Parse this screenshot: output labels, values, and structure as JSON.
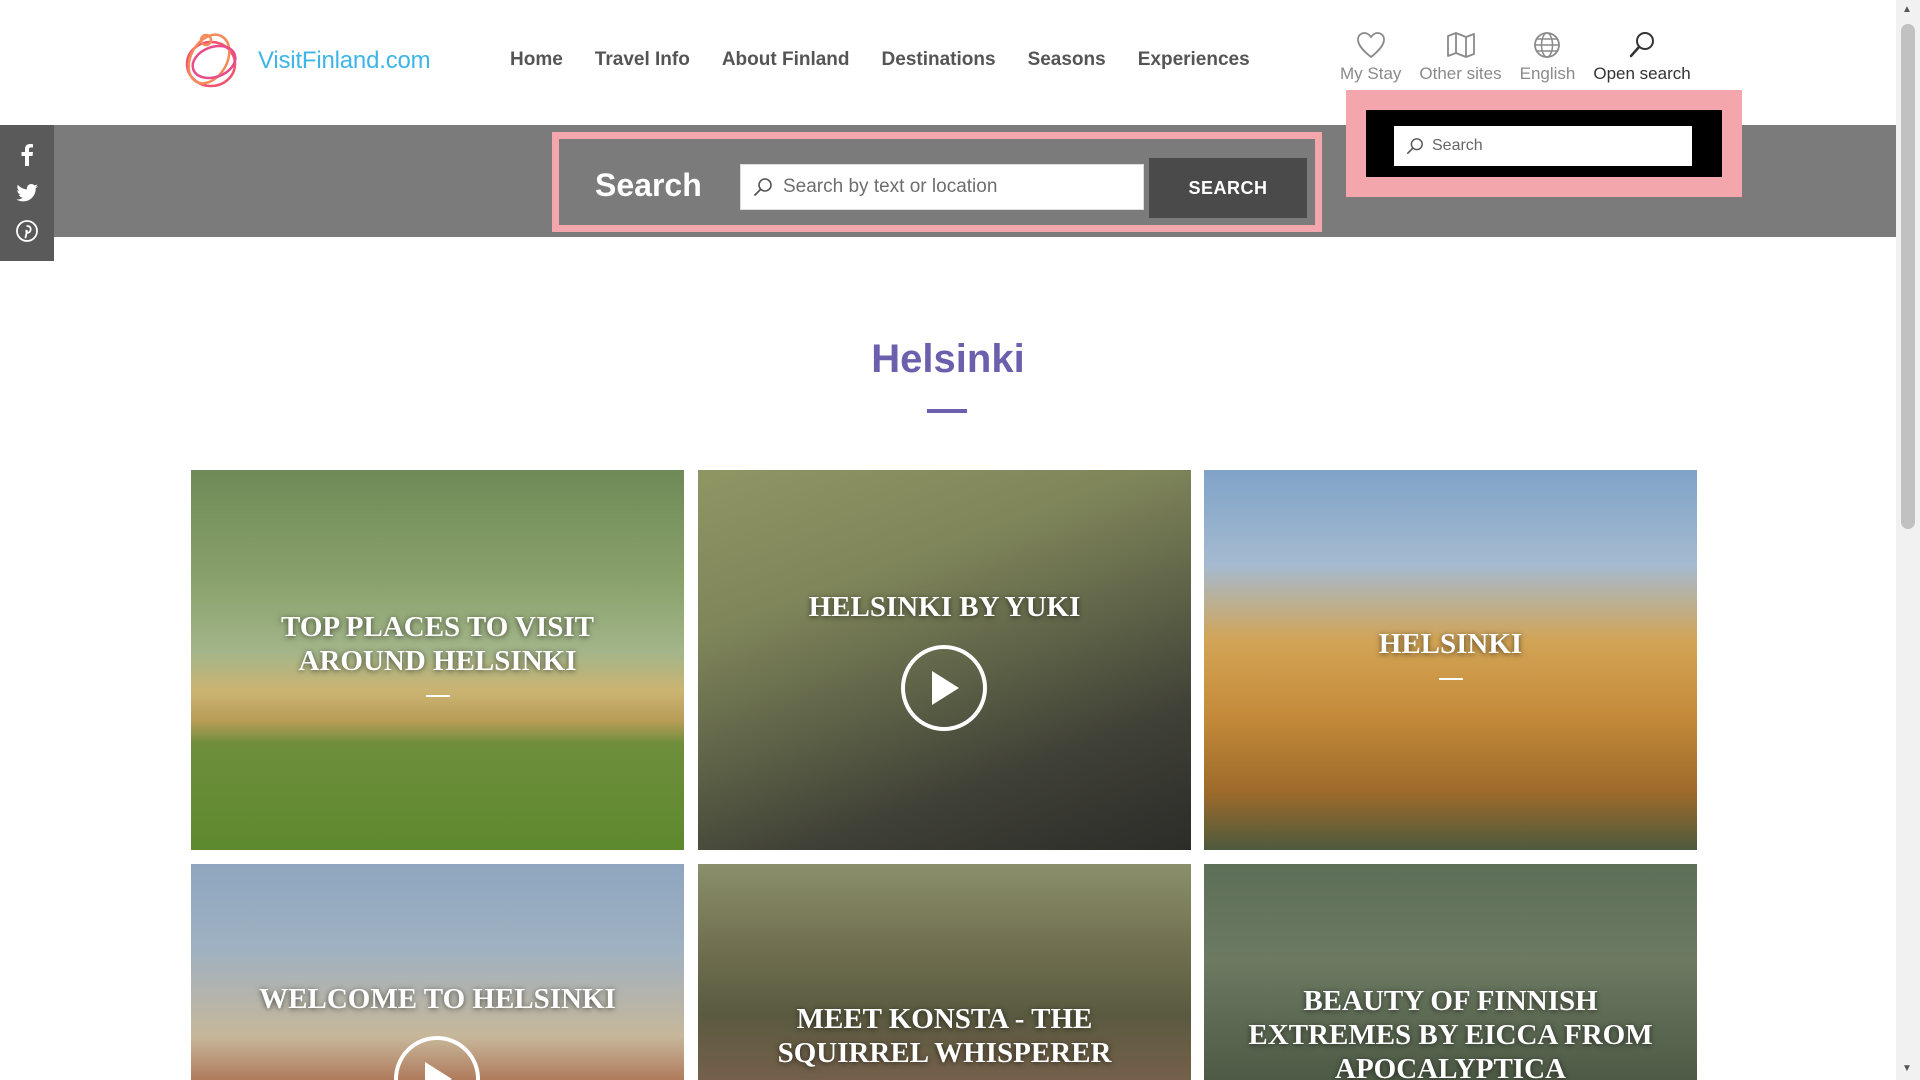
{
  "header": {
    "logo_text": "VisitFinland.com",
    "nav": [
      "Home",
      "Travel Info",
      "About Finland",
      "Destinations",
      "Seasons",
      "Experiences"
    ],
    "utility": [
      {
        "label": "My Stay",
        "icon": "heart-icon"
      },
      {
        "label": "Other sites",
        "icon": "map-icon"
      },
      {
        "label": "English",
        "icon": "globe-icon"
      },
      {
        "label": "Open search",
        "icon": "search-icon"
      }
    ]
  },
  "search_panel": {
    "title": "Search",
    "placeholder": "Search by text or location",
    "button_label": "SEARCH"
  },
  "mini_search": {
    "placeholder": "Search"
  },
  "social": [
    "facebook-icon",
    "twitter-icon",
    "pinterest-icon"
  ],
  "page": {
    "title": "Helsinki"
  },
  "cards": [
    {
      "title": "TOP PLACES TO VISIT AROUND HELSINKI",
      "video": false
    },
    {
      "title": "HELSINKI BY YUKI",
      "video": true
    },
    {
      "title": "HELSINKI",
      "video": false
    },
    {
      "title": "WELCOME TO HELSINKI",
      "video": true
    },
    {
      "title": "MEET KONSTA - THE SQUIRREL WHISPERER",
      "video": false
    },
    {
      "title": "BEAUTY OF FINNISH EXTREMES BY EICCA FROM APOCALYPTICA",
      "video": false
    }
  ],
  "colors": {
    "brand_blue": "#3db5e6",
    "title_purple": "#6b5fae",
    "band_grey": "#7b7b7b",
    "highlight_pink": "#f3a7ad"
  }
}
